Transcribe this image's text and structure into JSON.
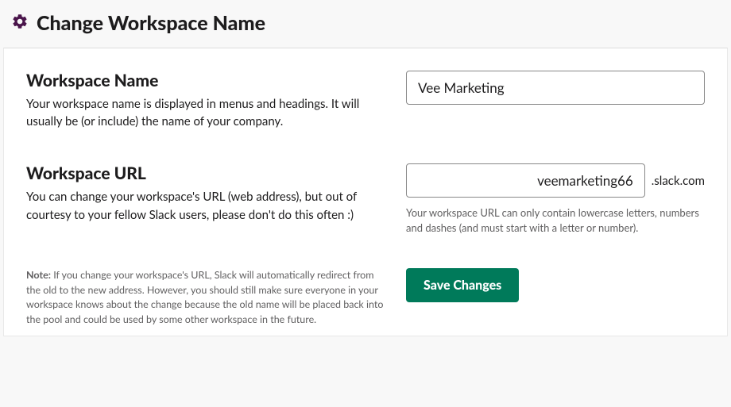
{
  "header": {
    "title": "Change Workspace Name"
  },
  "sections": {
    "name": {
      "heading": "Workspace Name",
      "description": "Your workspace name is displayed in menus and headings. It will usually be (or include) the name of your company.",
      "value": "Vee Marketing"
    },
    "url": {
      "heading": "Workspace URL",
      "description": "You can change your workspace's URL (web address), but out of courtesy to your fellow Slack users, please don't do this often :)",
      "value": "veemarketing66",
      "suffix": ".slack.com",
      "hint": "Your workspace URL can only contain lowercase letters, numbers and dashes (and must start with a letter or number)."
    }
  },
  "footer": {
    "note_label": "Note:",
    "note_text": " If you change your workspace's URL, Slack will automatically redirect from the old to the new address. However, you should still make sure everyone in your workspace knows about the change because the old name will be placed back into the pool and could be used by some other workspace in the future.",
    "save_label": "Save Changes"
  }
}
